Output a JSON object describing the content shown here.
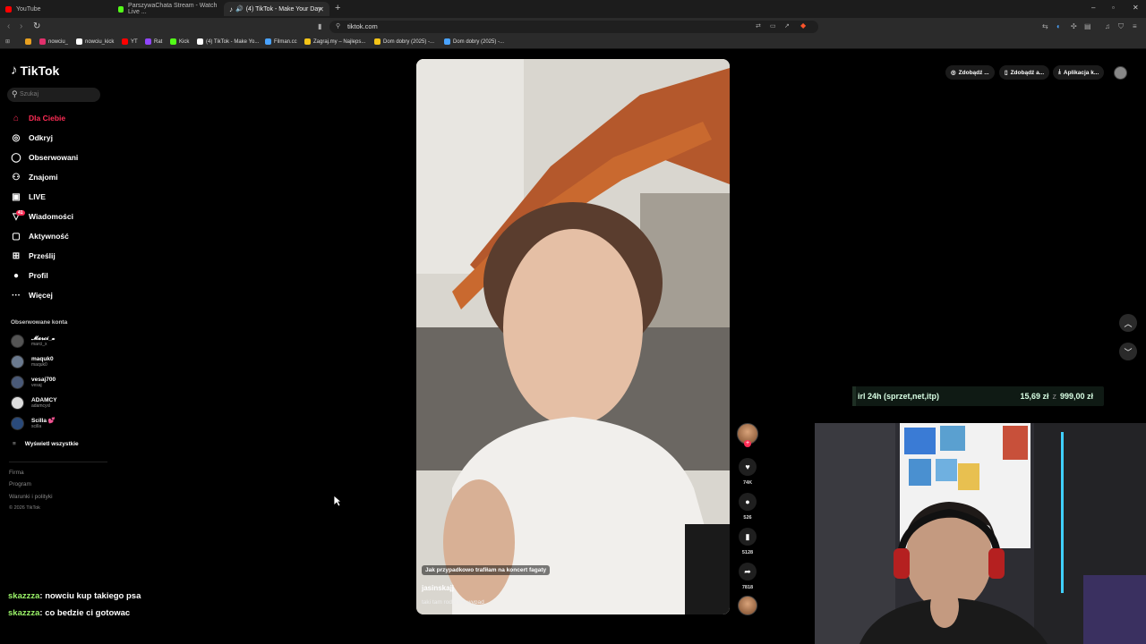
{
  "browser": {
    "tabs": [
      {
        "title": "YouTube",
        "active": false,
        "color": "#ff0000"
      },
      {
        "title": "ParszywaChata Stream - Watch Live ...",
        "active": false,
        "color": "#53fc18"
      },
      {
        "title": "(4) TikTok - Make Your Day",
        "active": true,
        "color": "#ffffff"
      }
    ],
    "new_tab": "+",
    "window_controls": [
      "–",
      "▫",
      "✕"
    ],
    "url": "tiktok.com",
    "bookmarks": [
      {
        "label": "",
        "color": "#e8a020"
      },
      {
        "label": "nowciu_",
        "color": "#e1306c"
      },
      {
        "label": "nowciu_kick",
        "color": "#ffffff"
      },
      {
        "label": "YT",
        "color": "#ff0000"
      },
      {
        "label": "Rat",
        "color": "#9146ff"
      },
      {
        "label": "Kick",
        "color": "#53fc18"
      },
      {
        "label": "(4) TikTok - Make Yo...",
        "color": "#ffffff"
      },
      {
        "label": "Filman.cc",
        "color": "#4aa3ff"
      },
      {
        "label": "Zagraj.my – Najleps...",
        "color": "#f5c518"
      },
      {
        "label": "Dom dobry (2025) -...",
        "color": "#f5c518"
      },
      {
        "label": "Dom dobry (2025) -...",
        "color": "#4aa3ff"
      }
    ]
  },
  "tiktok": {
    "logo": "TikTok",
    "search_placeholder": "Szukaj",
    "nav": [
      {
        "label": "Dla Ciebie",
        "icon": "home-icon",
        "glyph": "⌂",
        "active": true
      },
      {
        "label": "Odkryj",
        "icon": "compass-icon",
        "glyph": "◎",
        "active": false
      },
      {
        "label": "Obserwowani",
        "icon": "following-icon",
        "glyph": "◯",
        "active": false
      },
      {
        "label": "Znajomi",
        "icon": "friends-icon",
        "glyph": "⚇",
        "active": false
      },
      {
        "label": "LIVE",
        "icon": "live-icon",
        "glyph": "▣",
        "active": false
      },
      {
        "label": "Wiadomości",
        "icon": "messages-icon",
        "glyph": "▽",
        "active": false,
        "badge": "41"
      },
      {
        "label": "Aktywność",
        "icon": "activity-icon",
        "glyph": "▢",
        "active": false
      },
      {
        "label": "Prześlij",
        "icon": "upload-icon",
        "glyph": "⊞",
        "active": false
      },
      {
        "label": "Profil",
        "icon": "profile-icon",
        "glyph": "●",
        "active": false
      },
      {
        "label": "Więcej",
        "icon": "more-icon",
        "glyph": "···",
        "active": false
      }
    ],
    "followed_title": "Obserwowane konta",
    "followed": [
      {
        "name": "𝓜𝓪𝓻𝓬𝓲_𝔁",
        "handle": "marci_x"
      },
      {
        "name": "maquk0",
        "handle": "maquk0"
      },
      {
        "name": "vesaj700",
        "handle": "vesaj"
      },
      {
        "name": "ADAMCY",
        "handle": "adamcyxl"
      },
      {
        "name": "Scilla 💕",
        "handle": "scilla"
      }
    ],
    "show_all": "Wyświetl wszystkie",
    "footer": [
      "Firma",
      "Program",
      "Warunki i polityki",
      "© 2026 TikTok"
    ],
    "top_buttons": [
      "Zdobądź ...",
      "Zdobądź a...",
      "Aplikacja k..."
    ],
    "video": {
      "caption_box": "Jak przypadkowo trafiłam na koncert fagaty",
      "author": "jasinskajj",
      "description": "taki tam rodzinny wypad"
    },
    "actions": {
      "likes": "74K",
      "comments": "526",
      "saves": "5128",
      "shares": "7818"
    }
  },
  "stream_overlay": {
    "donation_label": "irl 24h (sprzet,net,itp)",
    "donation_current": "15,69 zł",
    "donation_separator": "z",
    "donation_goal": "999,00 zł",
    "donation_progress": 0.0157,
    "chat": [
      {
        "user": "skazzza",
        "message": ": nowciu kup takiego psa"
      },
      {
        "user": "skazzza",
        "message": ": co bedzie ci gotowac"
      }
    ]
  }
}
